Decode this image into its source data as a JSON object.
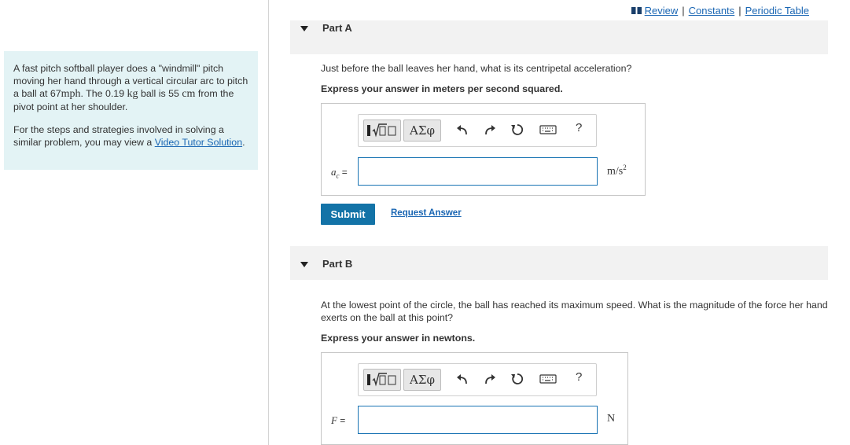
{
  "header": {
    "review_label": "Review",
    "constants_label": "Constants",
    "periodic_label": "Periodic Table",
    "separator": "|"
  },
  "intro": {
    "p1_a": "A fast pitch softball player does a \"windmill\" pitch moving her hand through a vertical circular arc to pitch a ball at 67",
    "p1_unit_mph": "mph",
    "p1_b": ". The 0.19 ",
    "p1_unit_kg": "kg",
    "p1_c": " ball is 55 ",
    "p1_unit_cm": "cm",
    "p1_d": "from the pivot point at her shoulder.",
    "p2_text": "For the steps and strategies involved in solving a similar problem, you may view a ",
    "p2_link": "Video Tutor Solution",
    "p2_end": "."
  },
  "part_a": {
    "title": "Part A",
    "question": "Just before the ball leaves her hand, what is its centripetal acceleration?",
    "instruction": "Express your answer in meters per second squared.",
    "greek_label": "ΑΣφ",
    "help_label": "?",
    "var_symbol": "a",
    "var_sub": "c",
    "equals": "=",
    "input_value": "",
    "unit": "m/s",
    "unit_exp": "2",
    "submit_label": "Submit",
    "request_label": "Request Answer"
  },
  "part_b": {
    "title": "Part B",
    "question": "At the lowest point of the circle, the ball has reached its maximum speed. What is the magnitude of the force her hand exerts on the ball at this point?",
    "instruction": "Express your answer in newtons.",
    "greek_label": "ΑΣφ",
    "help_label": "?",
    "var_symbol": "F",
    "equals": "=",
    "input_value": "",
    "unit": "N"
  }
}
